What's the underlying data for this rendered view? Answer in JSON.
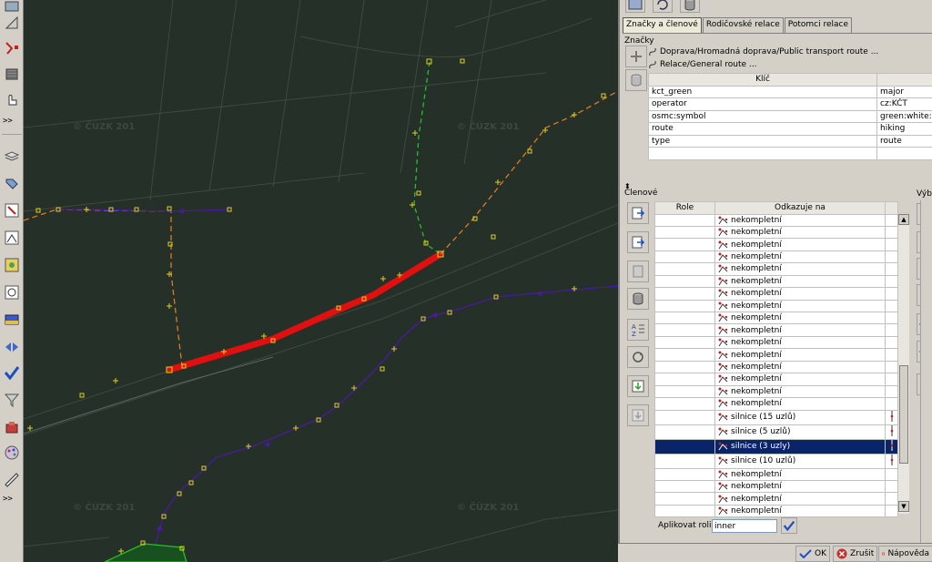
{
  "map": {
    "watermark": "© ČÚZK 201"
  },
  "panel": {
    "tabs": [
      "Značky a členové",
      "Rodičovské relace",
      "Potomci relace"
    ],
    "tags_label": "Značky",
    "relations": [
      "Doprava/Hromadná doprava/Public transport route ...",
      "Relace/General route ..."
    ],
    "tags_header": {
      "key": "Klíč",
      "value": ""
    },
    "tags": [
      {
        "key": "kct_green",
        "value": "major"
      },
      {
        "key": "operator",
        "value": "cz:KČT"
      },
      {
        "key": "osmc:symbol",
        "value": "green:white:g"
      },
      {
        "key": "route",
        "value": "hiking"
      },
      {
        "key": "type",
        "value": "route"
      }
    ],
    "members_label": "Členové",
    "selection_label": "Výbě",
    "members_header": {
      "role": "Role",
      "ref": "Odkazuje na"
    },
    "members": [
      {
        "role": "",
        "ref": "nekompletní",
        "kind": "incomplete"
      },
      {
        "role": "",
        "ref": "nekompletní",
        "kind": "incomplete"
      },
      {
        "role": "",
        "ref": "nekompletní",
        "kind": "incomplete"
      },
      {
        "role": "",
        "ref": "nekompletní",
        "kind": "incomplete"
      },
      {
        "role": "",
        "ref": "nekompletní",
        "kind": "incomplete"
      },
      {
        "role": "",
        "ref": "nekompletní",
        "kind": "incomplete"
      },
      {
        "role": "",
        "ref": "nekompletní",
        "kind": "incomplete"
      },
      {
        "role": "",
        "ref": "nekompletní",
        "kind": "incomplete"
      },
      {
        "role": "",
        "ref": "nekompletní",
        "kind": "incomplete"
      },
      {
        "role": "",
        "ref": "nekompletní",
        "kind": "incomplete"
      },
      {
        "role": "",
        "ref": "nekompletní",
        "kind": "incomplete"
      },
      {
        "role": "",
        "ref": "nekompletní",
        "kind": "incomplete"
      },
      {
        "role": "",
        "ref": "nekompletní",
        "kind": "incomplete"
      },
      {
        "role": "",
        "ref": "nekompletní",
        "kind": "incomplete"
      },
      {
        "role": "",
        "ref": "nekompletní",
        "kind": "incomplete"
      },
      {
        "role": "",
        "ref": "nekompletní",
        "kind": "incomplete"
      },
      {
        "role": "",
        "ref": "silnice (15 uzlů)",
        "kind": "way"
      },
      {
        "role": "",
        "ref": "silnice (5 uzlů)",
        "kind": "way"
      },
      {
        "role": "",
        "ref": "silnice (3 uzly)",
        "kind": "way",
        "selected": true
      },
      {
        "role": "",
        "ref": "silnice (10 uzlů)",
        "kind": "way"
      },
      {
        "role": "",
        "ref": "nekompletní",
        "kind": "incomplete"
      },
      {
        "role": "",
        "ref": "nekompletní",
        "kind": "incomplete"
      },
      {
        "role": "",
        "ref": "nekompletní",
        "kind": "incomplete"
      },
      {
        "role": "",
        "ref": "nekompletní",
        "kind": "incomplete"
      }
    ],
    "apply_role_label": "Aplikovat roli:",
    "role_value": "inner",
    "buttons": {
      "ok": "OK",
      "cancel": "Zrušit",
      "help": "Nápověda"
    }
  },
  "colors": {
    "map_bg": "#243028",
    "highlight": "#e01010",
    "route_orange": "#e07a20",
    "route_purple": "#4a1aa0",
    "route_green": "#28c028",
    "selection": "#0a246a"
  }
}
